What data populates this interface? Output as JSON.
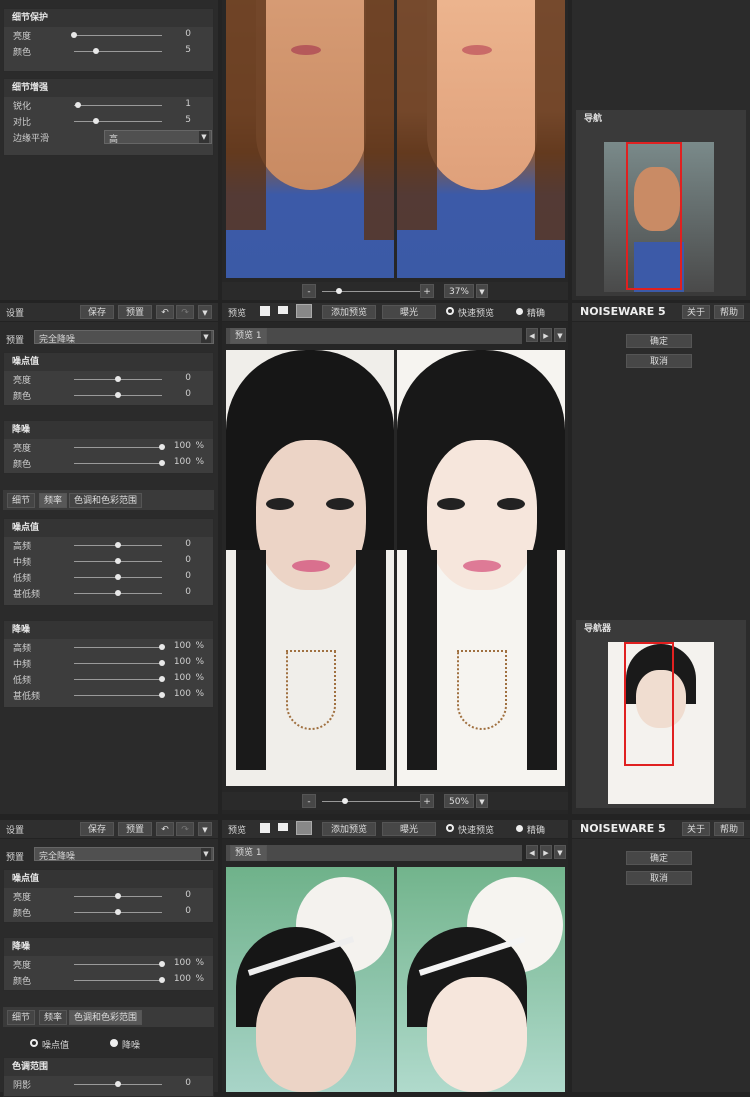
{
  "panel1": {
    "detail_protect": {
      "title": "细节保护",
      "rows": [
        {
          "label": "亮度",
          "value": "0",
          "pos": 0.0
        },
        {
          "label": "颜色",
          "value": "5",
          "pos": 0.25
        }
      ]
    },
    "detail_enhance": {
      "title": "细节增强",
      "rows": [
        {
          "label": "锐化",
          "value": "1",
          "pos": 0.05
        },
        {
          "label": "对比",
          "value": "5",
          "pos": 0.25
        }
      ],
      "edge_label": "边缘平滑",
      "edge_value": "高"
    },
    "zoom": "37%",
    "nav_title": "导航"
  },
  "panel2": {
    "toolbar": {
      "settings": "设置",
      "save": "保存",
      "preset": "预置"
    },
    "preset_label": "预置",
    "preset_value": "完全降噪",
    "noise_level": {
      "title": "噪点值",
      "rows": [
        {
          "label": "亮度",
          "value": "0",
          "pos": 0.5
        },
        {
          "label": "颜色",
          "value": "0",
          "pos": 0.5
        }
      ]
    },
    "reduction": {
      "title": "降噪",
      "rows": [
        {
          "label": "亮度",
          "value": "100",
          "unit": "%",
          "pos": 1
        },
        {
          "label": "颜色",
          "value": "100",
          "unit": "%",
          "pos": 1
        }
      ]
    },
    "tabs": [
      "细节",
      "频率",
      "色调和色彩范围"
    ],
    "freq_noise": {
      "title": "噪点值",
      "rows": [
        {
          "label": "高频",
          "value": "0",
          "pos": 0.5
        },
        {
          "label": "中频",
          "value": "0",
          "pos": 0.5
        },
        {
          "label": "低频",
          "value": "0",
          "pos": 0.5
        },
        {
          "label": "甚低频",
          "value": "0",
          "pos": 0.5
        }
      ]
    },
    "freq_reduction": {
      "title": "降噪",
      "rows": [
        {
          "label": "高频",
          "value": "100",
          "unit": "%",
          "pos": 1
        },
        {
          "label": "中频",
          "value": "100",
          "unit": "%",
          "pos": 1
        },
        {
          "label": "低频",
          "value": "100",
          "unit": "%",
          "pos": 1
        },
        {
          "label": "甚低频",
          "value": "100",
          "unit": "%",
          "pos": 1
        }
      ]
    },
    "preview_bar": {
      "preview": "预览",
      "add_preview": "添加预览",
      "exposure": "曝光",
      "fast": "快速预览",
      "accurate": "精确"
    },
    "preview_tab": "预览 1",
    "zoom": "50%",
    "brand": "NOISEWARE 5",
    "about": "关于",
    "help": "帮助",
    "ok": "确定",
    "cancel": "取消",
    "nav_title": "导航器"
  },
  "panel3": {
    "toolbar": {
      "settings": "设置",
      "save": "保存",
      "preset": "预置"
    },
    "preset_label": "预置",
    "preset_value": "完全降噪",
    "noise_level": {
      "title": "噪点值",
      "rows": [
        {
          "label": "亮度",
          "value": "0",
          "pos": 0.5
        },
        {
          "label": "颜色",
          "value": "0",
          "pos": 0.5
        }
      ]
    },
    "reduction": {
      "title": "降噪",
      "rows": [
        {
          "label": "亮度",
          "value": "100",
          "unit": "%",
          "pos": 1
        },
        {
          "label": "颜色",
          "value": "100",
          "unit": "%",
          "pos": 1
        }
      ]
    },
    "tabs": [
      "细节",
      "频率",
      "色调和色彩范围"
    ],
    "radio_noise": "噪点值",
    "radio_reduce": "降噪",
    "tone": {
      "title": "色调范围",
      "rows": [
        {
          "label": "阴影",
          "value": "0",
          "pos": 0.5
        }
      ]
    },
    "preview_bar": {
      "preview": "预览",
      "add_preview": "添加预览",
      "exposure": "曝光",
      "fast": "快速预览",
      "accurate": "精确"
    },
    "preview_tab": "预览 1",
    "brand": "NOISEWARE 5",
    "about": "关于",
    "help": "帮助",
    "ok": "确定",
    "cancel": "取消"
  }
}
